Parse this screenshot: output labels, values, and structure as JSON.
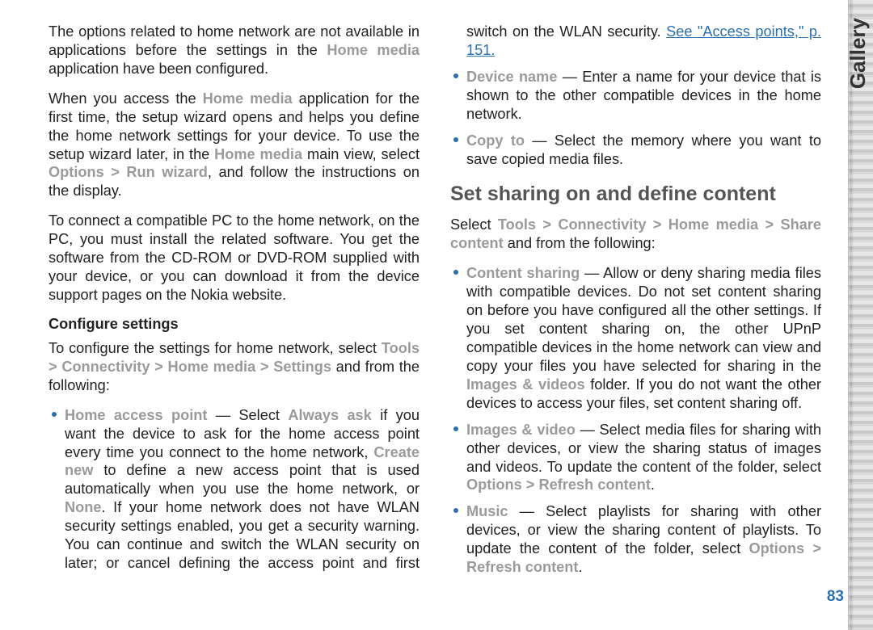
{
  "sidebar": {
    "tab": "Gallery",
    "page_number": "83"
  },
  "left": {
    "p1": {
      "t1": "The options related to home network are not available in applications before the settings in the ",
      "hm": "Home media",
      "t2": " application have been configured."
    },
    "p2": {
      "t1": "When you access the ",
      "hm": "Home media",
      "t2": " application for the first time, the setup wizard opens and helps you define the home network settings for your device. To use the setup wizard later, in the ",
      "hm2": "Home media",
      "t3": " main view, select ",
      "opt": "Options",
      "gt": " > ",
      "rw": "Run wizard",
      "t4": ", and follow the instructions on the display."
    },
    "p3": "To connect a compatible PC to the home network, on the PC, you must install the related software. You get the software from the CD-ROM or DVD-ROM supplied with your device, or you can download it from the device support pages on the Nokia website.",
    "h3": "Configure settings",
    "p4": {
      "t1": "To configure the settings for home network, select ",
      "path1": "Tools",
      "gt": " > ",
      "path2": "Connectivity",
      "path3": "Home media",
      "path4": "Settings",
      "t2": " and from the following:"
    },
    "li1": {
      "lbl": "Home access point",
      "dash": " — Select ",
      "aa": "Always ask",
      "t1": " if you want the device to ask for the home access point every time you connect to the home network, ",
      "cn": "Create new",
      "t2": " to define a new access point that is used automatically when you use the home network, or ",
      "none": "None",
      "t3": ". If your home network does not have WLAN security settings enabled, you get a security warning. You can continue and switch the WLAN security on later; or cancel defining the ",
      "cont": "access point and first switch on the WLAN security. ",
      "link": "See \"Access points,\" p. 151."
    },
    "li2": {
      "lbl": "Device name",
      "dash": " — Enter a name for your device that is shown to the other compatible devices in the home network."
    },
    "li3": {
      "lbl": "Copy to",
      "dash": " — Select the memory where you want to save copied media files."
    }
  },
  "right": {
    "h2": "Set sharing on and define content",
    "p1": {
      "t1": "Select ",
      "path1": "Tools",
      "gt": " > ",
      "path2": "Connectivity",
      "path3": "Home media",
      "path4": "Share content",
      "t2": " and from the following:"
    },
    "li1": {
      "lbl": "Content sharing",
      "t1": " — Allow or deny sharing media files with compatible devices. Do not set content sharing on before you have configured all the other settings. If you set content sharing on, the other UPnP compatible devices in the home network can view and copy your files you have selected for sharing in the ",
      "iv": "Images & videos",
      "t2": " folder. If you do not want the other devices to access your files, set content sharing off."
    },
    "li2": {
      "lbl": "Images & video",
      "t1": " — Select media files for sharing with other devices, or view the sharing status of images and videos. To update the content of the folder, select ",
      "opt": "Options",
      "gt": " > ",
      "rc": "Refresh content",
      "t2": "."
    },
    "li3": {
      "lbl": "Music",
      "t1": " — Select playlists for sharing with other devices, or view the sharing content of playlists. To update the content of the folder, select ",
      "opt": "Options",
      "gt": " > ",
      "rc": "Refresh content",
      "t2": "."
    }
  }
}
